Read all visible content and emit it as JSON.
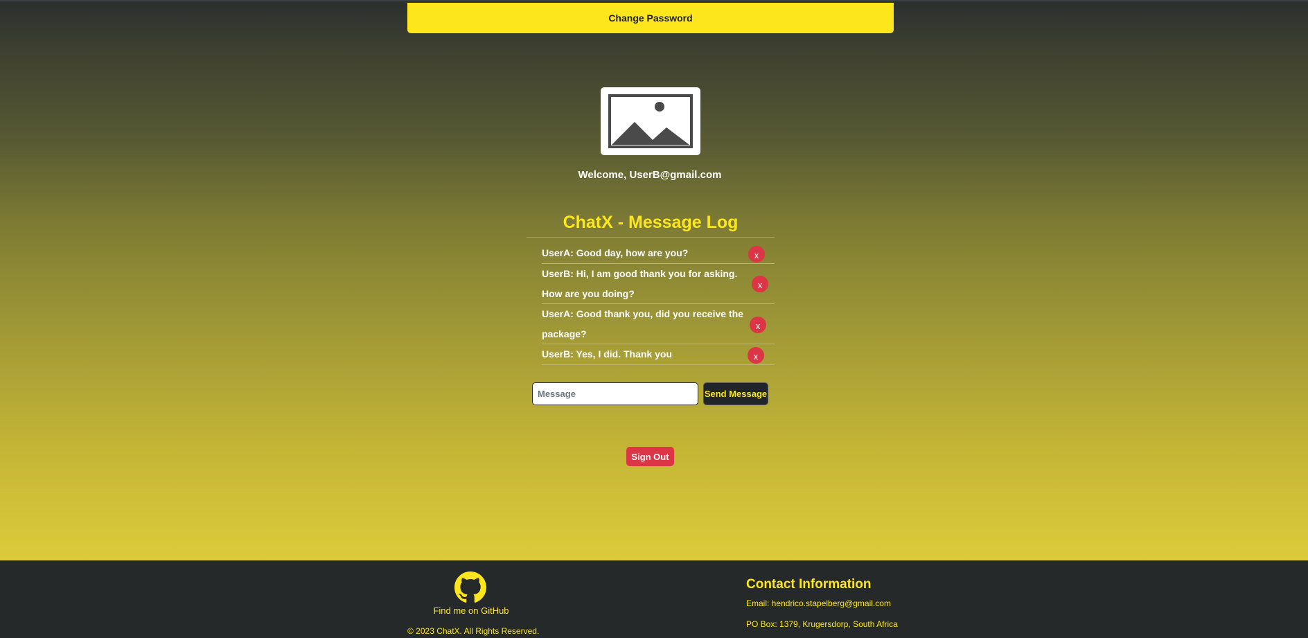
{
  "header": {
    "change_password_label": "Change Password"
  },
  "profile": {
    "avatar_icon": "image-placeholder-icon",
    "welcome_text": "Welcome, UserB@gmail.com"
  },
  "chat": {
    "title": "ChatX - Message Log",
    "messages": [
      {
        "text": "UserA: Good day, how are you?",
        "delete_label": "x"
      },
      {
        "text": "UserB: Hi, I am good thank you for asking. How are you doing?",
        "delete_label": "x"
      },
      {
        "text": "UserA: Good thank you, did you receive the package?",
        "delete_label": "x"
      },
      {
        "text": "UserB: Yes, I did. Thank you",
        "delete_label": "x"
      }
    ],
    "input_placeholder": "Message",
    "send_label": "Send Message"
  },
  "account": {
    "sign_out_label": "Sign Out"
  },
  "footer": {
    "github_icon": "github-icon",
    "github_label": "Find me on GitHub",
    "copyright": "© 2023 ChatX. All Rights Reserved.",
    "contact_title": "Contact Information",
    "email": "Email: hendrico.stapelberg@gmail.com",
    "po_box": "PO Box: 1379, Krugersdorp, South Africa"
  },
  "colors": {
    "accent": "#fde71c",
    "danger": "#dc3545",
    "dark": "#25292a"
  }
}
